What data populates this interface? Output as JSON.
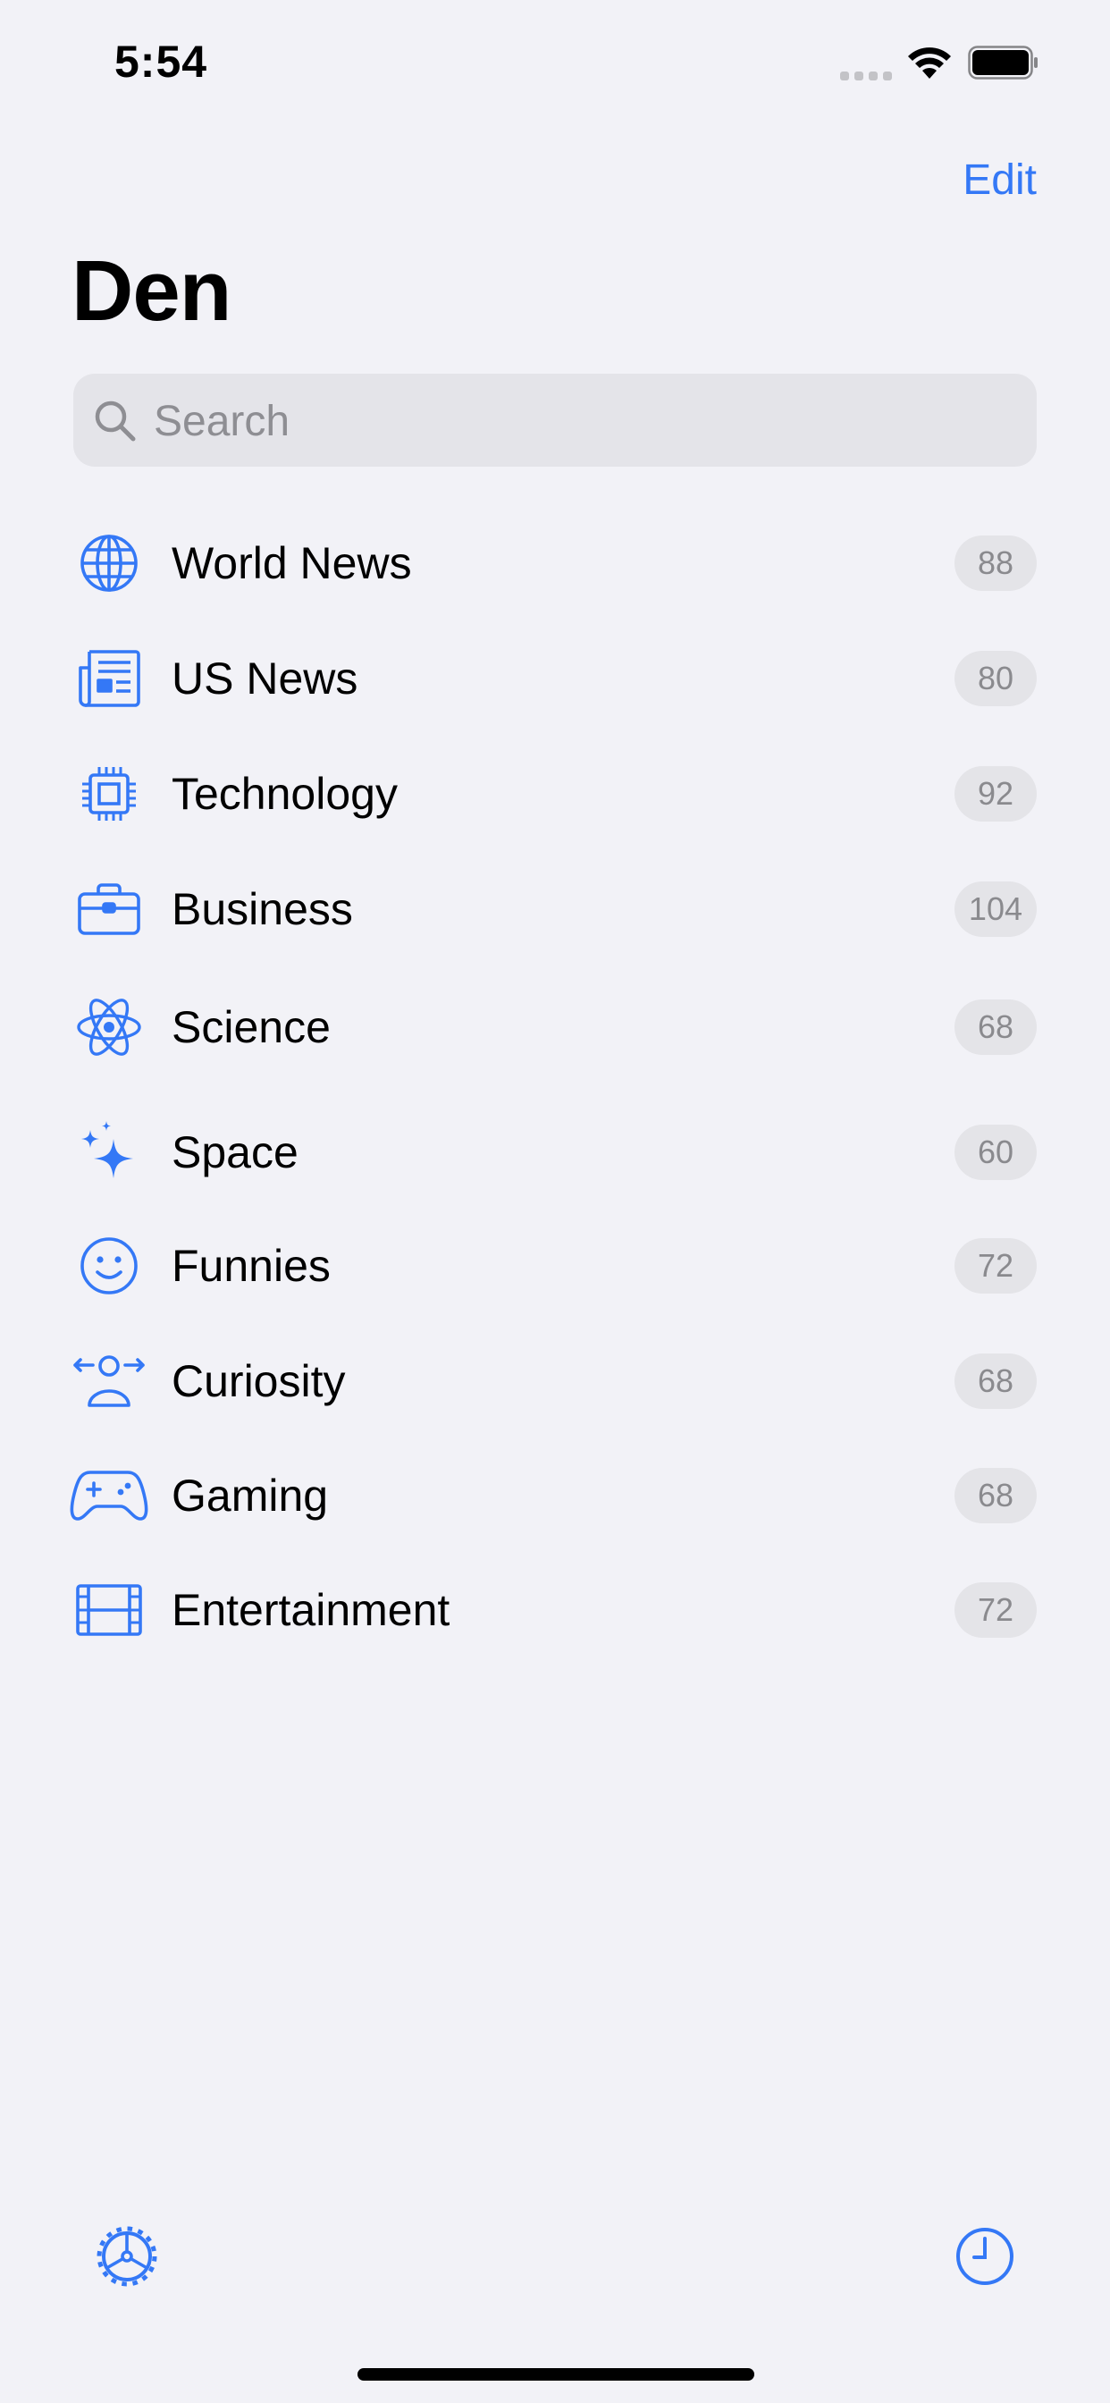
{
  "status_bar": {
    "time": "5:54"
  },
  "header": {
    "edit_label": "Edit",
    "title": "Den"
  },
  "search": {
    "placeholder": "Search",
    "value": ""
  },
  "accent_color": "#3478f6",
  "categories": [
    {
      "label": "World News",
      "count": "88",
      "icon": "globe-icon"
    },
    {
      "label": "US News",
      "count": "80",
      "icon": "newspaper-icon"
    },
    {
      "label": "Technology",
      "count": "92",
      "icon": "cpu-icon"
    },
    {
      "label": "Business",
      "count": "104",
      "icon": "briefcase-icon"
    },
    {
      "label": "Science",
      "count": "68",
      "icon": "atom-icon"
    },
    {
      "label": "Space",
      "count": "60",
      "icon": "sparkles-icon"
    },
    {
      "label": "Funnies",
      "count": "72",
      "icon": "smiley-icon"
    },
    {
      "label": "Curiosity",
      "count": "68",
      "icon": "person-arrows-icon"
    },
    {
      "label": "Gaming",
      "count": "68",
      "icon": "gamecontroller-icon"
    },
    {
      "label": "Entertainment",
      "count": "72",
      "icon": "film-icon"
    }
  ],
  "toolbar": {
    "left_icon": "gear-icon",
    "right_icon": "clock-icon"
  }
}
